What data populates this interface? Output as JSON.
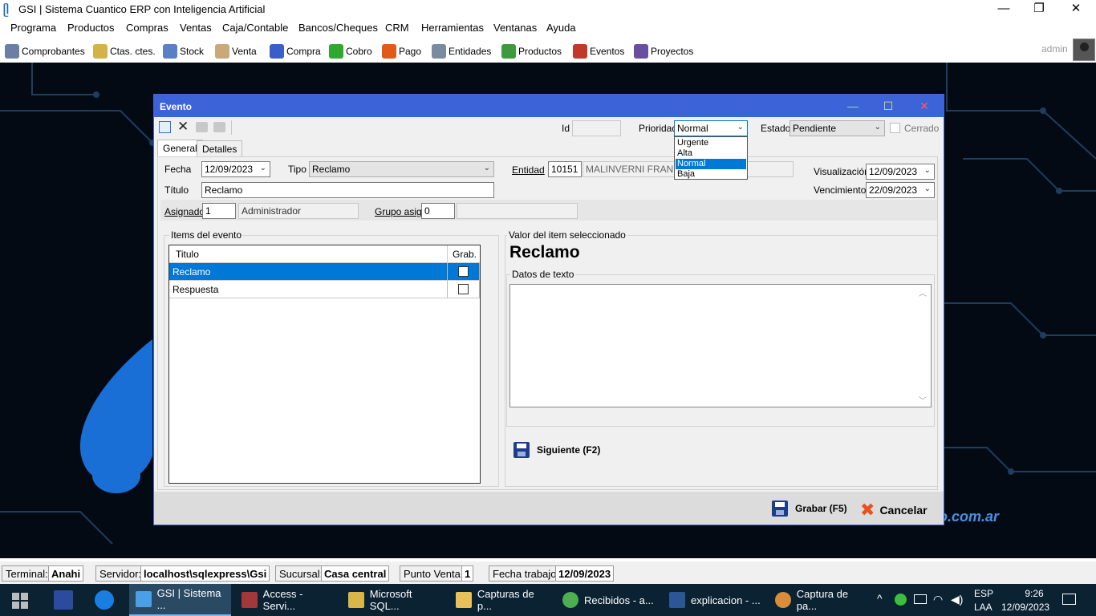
{
  "app": {
    "title": "GSI | Sistema Cuantico ERP con Inteligencia Artificial",
    "logo_glyph": "ᥫ",
    "window_controls": {
      "minimize": "—",
      "maximize": "❐",
      "close": "✕"
    }
  },
  "menu": [
    "Programa",
    "Productos",
    "Compras",
    "Ventas",
    "Caja/Contable",
    "Bancos/Cheques",
    "CRM",
    "Herramientas",
    "Ventanas",
    "Ayuda"
  ],
  "toolbar": {
    "items": [
      {
        "label": "Comprobantes",
        "icon": "comprobantes-icon",
        "color": "#6b7fa6"
      },
      {
        "label": "Ctas. ctes.",
        "icon": "folders-icon",
        "color": "#d4b24a"
      },
      {
        "label": "Stock",
        "icon": "stock-icon",
        "color": "#5b7fc4"
      },
      {
        "label": "Venta",
        "icon": "hand-icon",
        "color": "#c9a87a"
      },
      {
        "label": "Compra",
        "icon": "cart-icon",
        "color": "#3a5ec9"
      },
      {
        "label": "Cobro",
        "icon": "dollar-in-icon",
        "color": "#2ea82e"
      },
      {
        "label": "Pago",
        "icon": "dollar-out-icon",
        "color": "#e05a1a"
      },
      {
        "label": "Entidades",
        "icon": "entidades-icon",
        "color": "#7a8aa0"
      },
      {
        "label": "Productos",
        "icon": "box-icon",
        "color": "#3d9a3d"
      },
      {
        "label": "Eventos",
        "icon": "eventos-icon",
        "color": "#c0392b"
      },
      {
        "label": "Proyectos",
        "icon": "proyectos-icon",
        "color": "#6a4fa0"
      }
    ],
    "user": "admin"
  },
  "desktop": {
    "watermark": "o.com.ar"
  },
  "dialog": {
    "title": "Evento",
    "controls": {
      "minimize": "—",
      "maximize": "☐",
      "close": "✕"
    },
    "top": {
      "id_label": "Id",
      "id_value": "",
      "prioridad_label": "Prioridad",
      "prioridad_value": "Normal",
      "prioridad_options": [
        "Urgente",
        "Alta",
        "Normal",
        "Baja"
      ],
      "estado_label": "Estado",
      "estado_value": "Pendiente",
      "cerrado_label": "Cerrado"
    },
    "tabs": [
      "General",
      "Detalles"
    ],
    "general": {
      "fecha_label": "Fecha",
      "fecha_value": "12/09/2023",
      "tipo_label": "Tipo",
      "tipo_value": "Reclamo",
      "entidad_label": "Entidad",
      "entidad_code": "10151",
      "entidad_name": "MALINVERNI FRANCIS",
      "visualizacion_label": "Visualización",
      "visualizacion_value": "12/09/2023",
      "vencimiento_label": "Vencimiento",
      "vencimiento_value": "22/09/2023",
      "titulo_label": "Título",
      "titulo_value": "Reclamo",
      "asignado_label": "Asignado",
      "asignado_code": "1",
      "asignado_name": "Administrador",
      "grupo_label": "Grupo asig.",
      "grupo_code": "0",
      "grupo_name": ""
    },
    "items": {
      "group_title": "Items del evento",
      "columns": [
        "Titulo",
        "Grab."
      ],
      "rows": [
        {
          "titulo": "Reclamo",
          "grab": false
        },
        {
          "titulo": "Respuesta",
          "grab": false
        }
      ]
    },
    "valor": {
      "group_title": "Valor del item seleccionado",
      "heading": "Reclamo",
      "datos_title": "Datos de texto",
      "datos_value": ""
    },
    "buttons": {
      "siguiente": "Siguiente (F2)",
      "grabar": "Grabar (F5)",
      "cancelar": "Cancelar"
    }
  },
  "statusbar": {
    "terminal_label": "Terminal:",
    "terminal_value": "Anahi",
    "servidor_label": "Servidor:",
    "servidor_value": "localhost\\sqlexpress\\Gsi",
    "sucursal_label": "Sucursal:",
    "sucursal_value": "Casa central",
    "punto_label": "Punto Venta:",
    "punto_value": "1",
    "fecha_label": "Fecha trabajo:",
    "fecha_value": "12/09/2023"
  },
  "taskbar": {
    "apps": [
      {
        "label": "GSI | Sistema ...",
        "icon": "gsi-icon",
        "color": "#4aa0e6",
        "active": true
      },
      {
        "label": "Access - Servi...",
        "icon": "access-icon",
        "color": "#a4373a",
        "active": false
      },
      {
        "label": "Microsoft SQL...",
        "icon": "sql-icon",
        "color": "#d8b64a",
        "active": false
      },
      {
        "label": "Capturas de p...",
        "icon": "folder-icon",
        "color": "#e8c15a",
        "active": false
      },
      {
        "label": "Recibidos - a...",
        "icon": "chrome-icon",
        "color": "#4caf50",
        "active": false
      },
      {
        "label": "explicacion - ...",
        "icon": "word-icon",
        "color": "#2b5797",
        "active": false
      },
      {
        "label": "Captura de pa...",
        "icon": "paint-icon",
        "color": "#d98c3a",
        "active": false
      }
    ],
    "lang_top": "ESP",
    "lang_bottom": "LAA",
    "time": "9:26",
    "date": "12/09/2023"
  }
}
